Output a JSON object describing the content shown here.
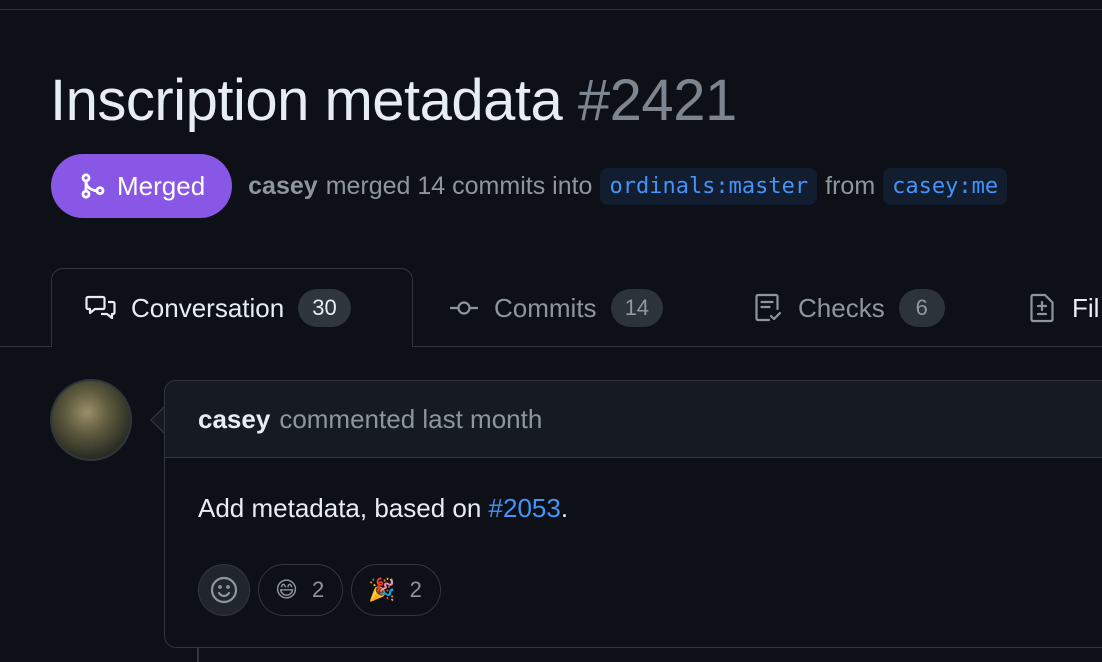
{
  "pr": {
    "title": "Inscription metadata",
    "number": "#2421",
    "state_label": "Merged",
    "author": "casey",
    "merged_text": "merged 14 commits into",
    "base_branch": "ordinals:master",
    "from_text": "from",
    "head_branch": "casey:me"
  },
  "tabs": [
    {
      "label": "Conversation",
      "count": "30",
      "icon": "comment-discussion-icon"
    },
    {
      "label": "Commits",
      "count": "14",
      "icon": "git-commit-icon"
    },
    {
      "label": "Checks",
      "count": "6",
      "icon": "checklist-icon"
    },
    {
      "label": "Fil",
      "icon": "file-diff-icon"
    }
  ],
  "comment": {
    "author": "casey",
    "meta": "commented last month",
    "body_text": "Add metadata, based on ",
    "body_link": "#2053",
    "body_suffix": ".",
    "reactions": [
      {
        "emoji": "😄",
        "count": "2"
      },
      {
        "emoji": "🎉",
        "count": "2"
      }
    ]
  },
  "colors": {
    "background": "#0d1117",
    "merged": "#8957e5",
    "link": "#4493f8",
    "muted": "#8d96a0",
    "border": "#30363d"
  }
}
